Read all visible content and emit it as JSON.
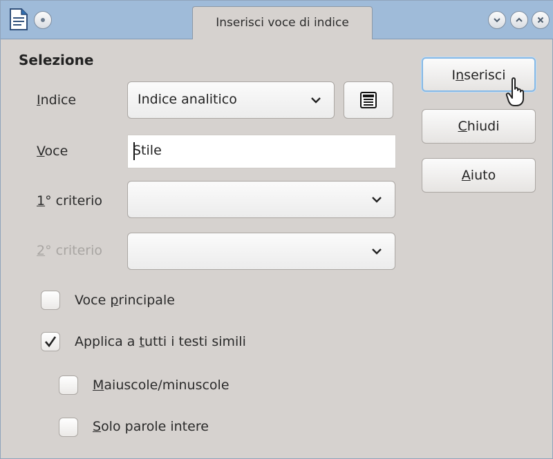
{
  "window": {
    "title": "Inserisci voce di indice",
    "controls": [
      "minimize",
      "maximize",
      "close"
    ]
  },
  "section": {
    "title": "Selezione"
  },
  "fields": {
    "indice": {
      "label_mnemonic": "I",
      "label_rest": "ndice",
      "value": "Indice analitico"
    },
    "voce": {
      "label_mnemonic": "V",
      "label_rest": "oce",
      "value": "Stile"
    },
    "criterio1": {
      "label_mnemonic": "1",
      "label_rest": "° criterio",
      "value": ""
    },
    "criterio2": {
      "label_mnemonic": "2",
      "label_rest": "° criterio",
      "value": "",
      "disabled": true
    }
  },
  "checkboxes": {
    "voce_principale": {
      "label_before": "Voce ",
      "label_mnemonic": "p",
      "label_after": "rincipale",
      "checked": false
    },
    "applica": {
      "label_before": "Applica a ",
      "label_mnemonic": "t",
      "label_after": "utti i testi simili",
      "checked": true
    },
    "maiuscole": {
      "label_before": "",
      "label_mnemonic": "M",
      "label_after": "aiuscole/minuscole",
      "checked": false
    },
    "solo_parole": {
      "label_before": "",
      "label_mnemonic": "S",
      "label_after": "olo parole intere",
      "checked": false
    }
  },
  "buttons": {
    "inserisci": {
      "before": "I",
      "mnemonic": "n",
      "after": "serisci"
    },
    "chiudi": {
      "before": "",
      "mnemonic": "C",
      "after": "hiudi"
    },
    "aiuto": {
      "before": "",
      "mnemonic": "A",
      "after": "iuto"
    }
  },
  "icons": {
    "app": "writer-document-icon",
    "menu": "window-menu-icon",
    "new_index": "index-list-icon",
    "dropdown": "chevron-down-icon",
    "cursor": "hand-pointer-icon"
  },
  "colors": {
    "titlebar": "#9fbbd9",
    "dialog_bg": "#d6d2cf",
    "default_button_border": "#86b9e6"
  }
}
